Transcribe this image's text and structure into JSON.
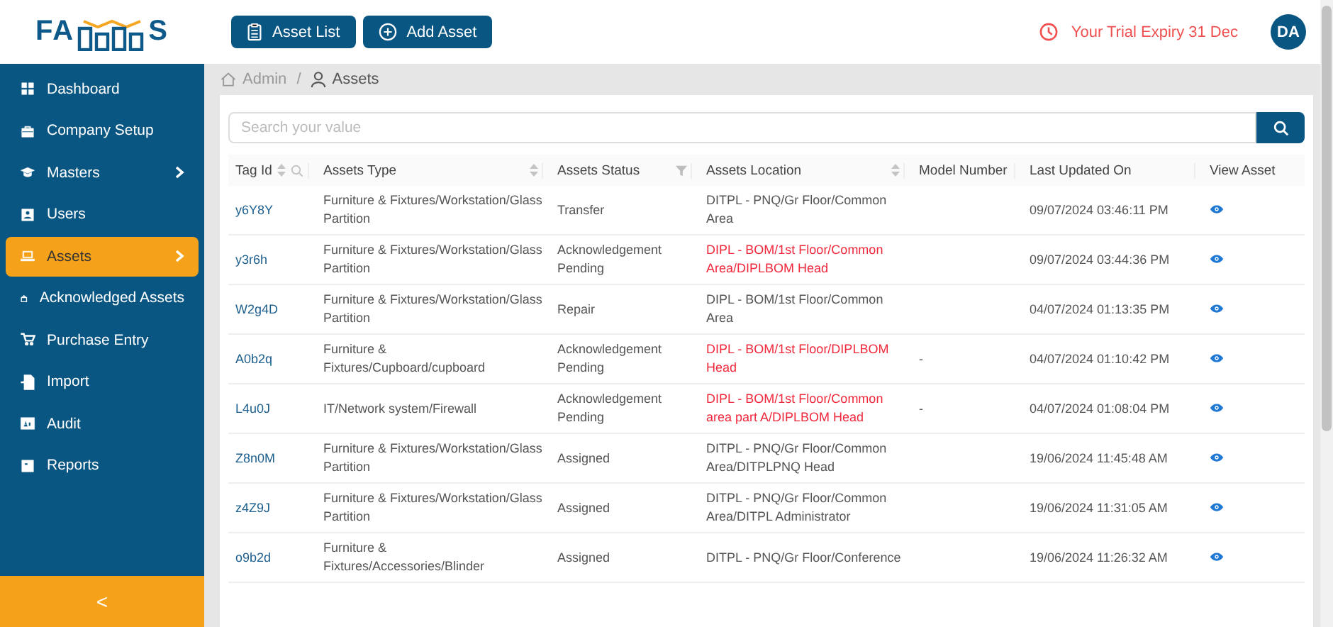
{
  "logo": {
    "left": "FA",
    "right": "S"
  },
  "toolbar": {
    "buttons": [
      {
        "label": "Asset List",
        "kind": "list"
      },
      {
        "label": "Add Asset",
        "kind": "add"
      }
    ],
    "trial": "Your Trial Expiry 31 Dec",
    "avatar": "DA"
  },
  "sidebar": {
    "items": [
      {
        "label": "Dashboard",
        "has_submenu": false,
        "selected": false
      },
      {
        "label": "Company Setup",
        "has_submenu": false,
        "selected": false
      },
      {
        "label": "Masters",
        "has_submenu": true,
        "selected": false
      },
      {
        "label": "Users",
        "has_submenu": false,
        "selected": false
      },
      {
        "label": "Assets",
        "has_submenu": true,
        "selected": true
      },
      {
        "label": "Acknowledged Assets",
        "has_submenu": false,
        "selected": false
      },
      {
        "label": "Purchase Entry",
        "has_submenu": false,
        "selected": false
      },
      {
        "label": "Import",
        "has_submenu": false,
        "selected": false
      },
      {
        "label": "Audit",
        "has_submenu": false,
        "selected": false
      },
      {
        "label": "Reports",
        "has_submenu": false,
        "selected": false
      }
    ],
    "collapse": "<"
  },
  "breadcrumb": [
    "Admin",
    "/",
    "Assets"
  ],
  "search": {
    "placeholder": "Search your value"
  },
  "table": {
    "columns": [
      {
        "label": "Tag Id",
        "sortable": true,
        "searchable": true,
        "filterable": false
      },
      {
        "label": "Assets Type",
        "sortable": true,
        "searchable": false,
        "filterable": false
      },
      {
        "label": "Assets Status",
        "sortable": false,
        "searchable": false,
        "filterable": true
      },
      {
        "label": "Assets Location",
        "sortable": true,
        "searchable": false,
        "filterable": false
      },
      {
        "label": "Model Number",
        "sortable": false,
        "searchable": false,
        "filterable": false
      },
      {
        "label": "Last Updated On",
        "sortable": false,
        "searchable": false,
        "filterable": false
      },
      {
        "label": "View Asset",
        "sortable": false,
        "searchable": false,
        "filterable": false
      }
    ],
    "rows": [
      {
        "tag": "y6Y8Y",
        "type": "Furniture & Fixtures/Workstation/Glass Partition",
        "status": "Transfer",
        "location": "DITPL - PNQ/Gr Floor/Common Area",
        "location_alert": false,
        "model": "",
        "updated": "09/07/2024 03:46:11 PM"
      },
      {
        "tag": "y3r6h",
        "type": "Furniture & Fixtures/Workstation/Glass Partition",
        "status": "Acknowledgement Pending",
        "location": "DIPL - BOM/1st Floor/Common Area/DIPLBOM Head",
        "location_alert": true,
        "model": "",
        "updated": "09/07/2024 03:44:36 PM"
      },
      {
        "tag": "W2g4D",
        "type": "Furniture & Fixtures/Workstation/Glass Partition",
        "status": "Repair",
        "location": "DIPL - BOM/1st Floor/Common Area",
        "location_alert": false,
        "model": "",
        "updated": "04/07/2024 01:13:35 PM"
      },
      {
        "tag": "A0b2q",
        "type": "Furniture & Fixtures/Cupboard/cupboard",
        "status": "Acknowledgement Pending",
        "location": "DIPL - BOM/1st Floor/DIPLBOM Head",
        "location_alert": true,
        "model": "-",
        "updated": "04/07/2024 01:10:42 PM"
      },
      {
        "tag": "L4u0J",
        "type": "IT/Network system/Firewall",
        "status": "Acknowledgement Pending",
        "location": "DIPL - BOM/1st Floor/Common area part A/DIPLBOM Head",
        "location_alert": true,
        "model": "-",
        "updated": "04/07/2024 01:08:04 PM"
      },
      {
        "tag": "Z8n0M",
        "type": "Furniture & Fixtures/Workstation/Glass Partition",
        "status": "Assigned",
        "location": "DITPL - PNQ/Gr Floor/Common Area/DITPLPNQ Head",
        "location_alert": false,
        "model": "",
        "updated": "19/06/2024 11:45:48 AM"
      },
      {
        "tag": "z4Z9J",
        "type": "Furniture & Fixtures/Workstation/Glass Partition",
        "status": "Assigned",
        "location": "DITPL - PNQ/Gr Floor/Common Area/DITPL Administrator",
        "location_alert": false,
        "model": "",
        "updated": "19/06/2024 11:31:05 AM"
      },
      {
        "tag": "o9b2d",
        "type": "Furniture & Fixtures/Accessories/Blinder",
        "status": "Assigned",
        "location": "DITPL - PNQ/Gr Floor/Conference",
        "location_alert": false,
        "model": "",
        "updated": "19/06/2024 11:26:32 AM"
      }
    ]
  }
}
